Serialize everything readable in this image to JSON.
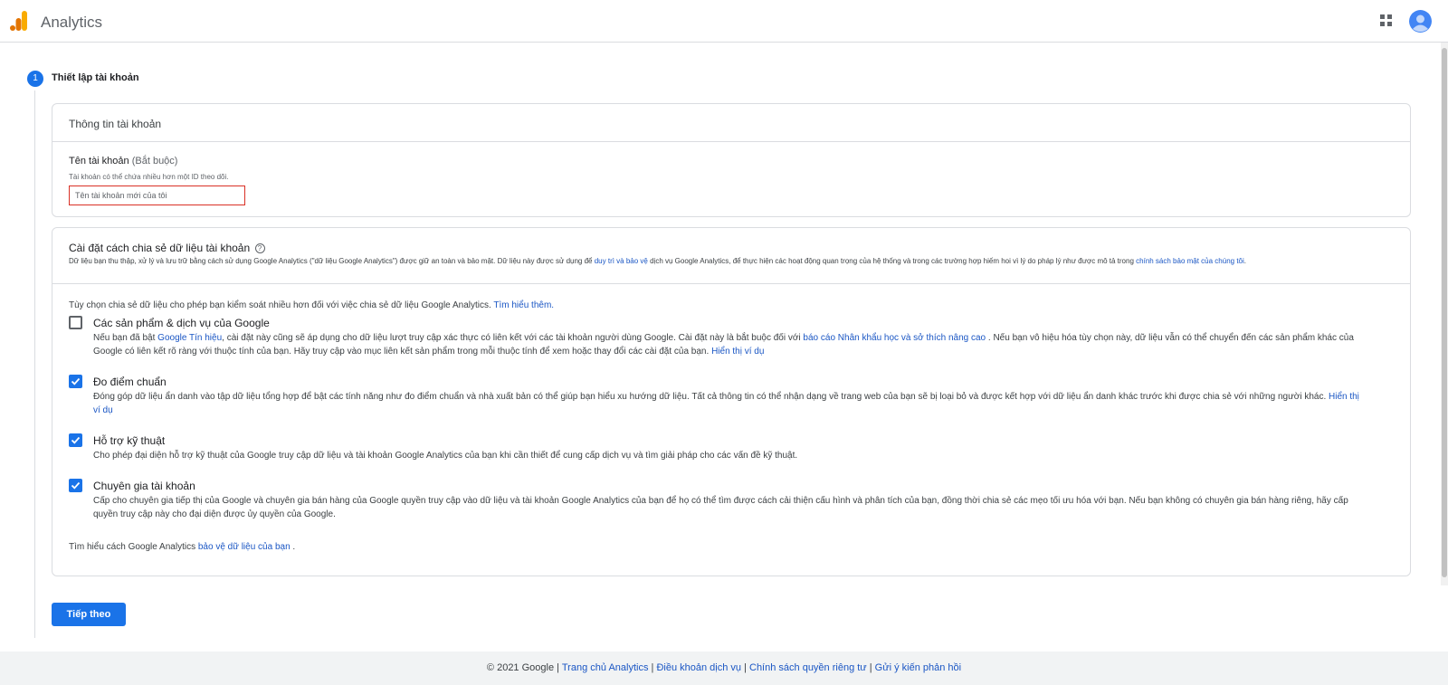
{
  "header": {
    "app_title": "Analytics"
  },
  "step": {
    "number": "1",
    "label": "Thiết lập tài khoản"
  },
  "account_card": {
    "title": "Thông tin tài khoản",
    "field_label": "Tên tài khoản",
    "field_required": "(Bắt buộc)",
    "field_hint": "Tài khoản có thể chứa nhiều hơn một ID theo dõi.",
    "input_placeholder": "Tên tài khoản mới của tôi",
    "input_value": ""
  },
  "sharing_card": {
    "title": "Cài đặt cách chia sẻ dữ liệu tài khoản",
    "help_icon": "?",
    "desc_part1": "Dữ liệu bạn thu thập, xử lý và lưu trữ bằng cách sử dụng Google Analytics (\"dữ liệu Google Analytics\") được giữ an toàn và bảo mật. Dữ liệu này được sử dụng để ",
    "desc_link1": "duy trì và bảo vệ",
    "desc_part2": " dịch vụ Google Analytics, để thực hiện các hoạt động quan trọng của hệ thống và trong các trường hợp hiếm hoi vì lý do pháp lý như được mô tả trong ",
    "desc_link2": "chính sách bảo mật của chúng tôi",
    "desc_part3": ".",
    "intro_text": "Tùy chọn chia sẻ dữ liệu cho phép bạn kiểm soát nhiều hơn đối với việc chia sẻ dữ liệu Google Analytics. ",
    "intro_link": "Tìm hiểu thêm.",
    "options": [
      {
        "title": "Các sản phẩm & dịch vụ của Google",
        "checked": false,
        "desc_a": "Nếu bạn đã bật ",
        "link_a": "Google Tín hiệu",
        "desc_b": ", cài đặt này cũng sẽ áp dụng cho dữ liệu lượt truy cập xác thực có liên kết với các tài khoản người dùng Google. Cài đặt này là bắt buộc đối với ",
        "link_b": "báo cáo Nhân khẩu học và sở thích nâng cao",
        "desc_c": " . Nếu bạn vô hiệu hóa tùy chọn này, dữ liệu vẫn có thể chuyển đến các sản phẩm khác của Google có liên kết rõ ràng với thuộc tính của bạn. Hãy truy cập vào mục liên kết sản phẩm trong mỗi thuộc tính để xem hoặc thay đổi các cài đặt của bạn.  ",
        "link_c": "Hiển thị ví dụ"
      },
      {
        "title": "Đo điểm chuẩn",
        "checked": true,
        "desc_a": "Đóng góp dữ liệu ẩn danh vào tập dữ liệu tổng hợp để bật các tính năng như đo điểm chuẩn và nhà xuất bản có thể giúp bạn hiểu xu hướng dữ liệu. Tất cả thông tin có thể nhận dạng về trang web của bạn sẽ bị loại bỏ và được kết hợp với dữ liệu ẩn danh khác trước khi được chia sẻ với những người khác.  ",
        "link_a": "Hiển thị ví dụ"
      },
      {
        "title": "Hỗ trợ kỹ thuật",
        "checked": true,
        "desc_a": "Cho phép đại diện hỗ trợ kỹ thuật của Google truy cập dữ liệu và tài khoản Google Analytics của bạn khi cần thiết để cung cấp dịch vụ và tìm giải pháp cho các vấn đề kỹ thuật."
      },
      {
        "title": "Chuyên gia tài khoản",
        "checked": true,
        "desc_a": "Cấp cho chuyên gia tiếp thị của Google và chuyên gia bán hàng của Google quyền truy cập vào dữ liệu và tài khoản Google Analytics của bạn để họ có thể tìm được cách cải thiện cấu hình và phân tích của bạn, đồng thời chia sẻ các mẹo tối ưu hóa với bạn. Nếu bạn không có chuyên gia bán hàng riêng, hãy cấp quyền truy cập này cho đại diện được ủy quyền của Google."
      }
    ],
    "protect_text": "Tìm hiểu cách Google Analytics ",
    "protect_link": "bảo vệ dữ liệu của bạn",
    "protect_end": " ."
  },
  "next_button": "Tiếp theo",
  "footer": {
    "copyright": "© 2021 Google",
    "sep": " | ",
    "links": [
      "Trang chủ Analytics",
      "Điều khoản dịch vụ",
      "Chính sách quyền riêng tư",
      "Gửi ý kiến phản hồi"
    ]
  },
  "colors": {
    "accent": "#1a73e8",
    "link": "#1a56c4",
    "error_border": "#d93025"
  }
}
